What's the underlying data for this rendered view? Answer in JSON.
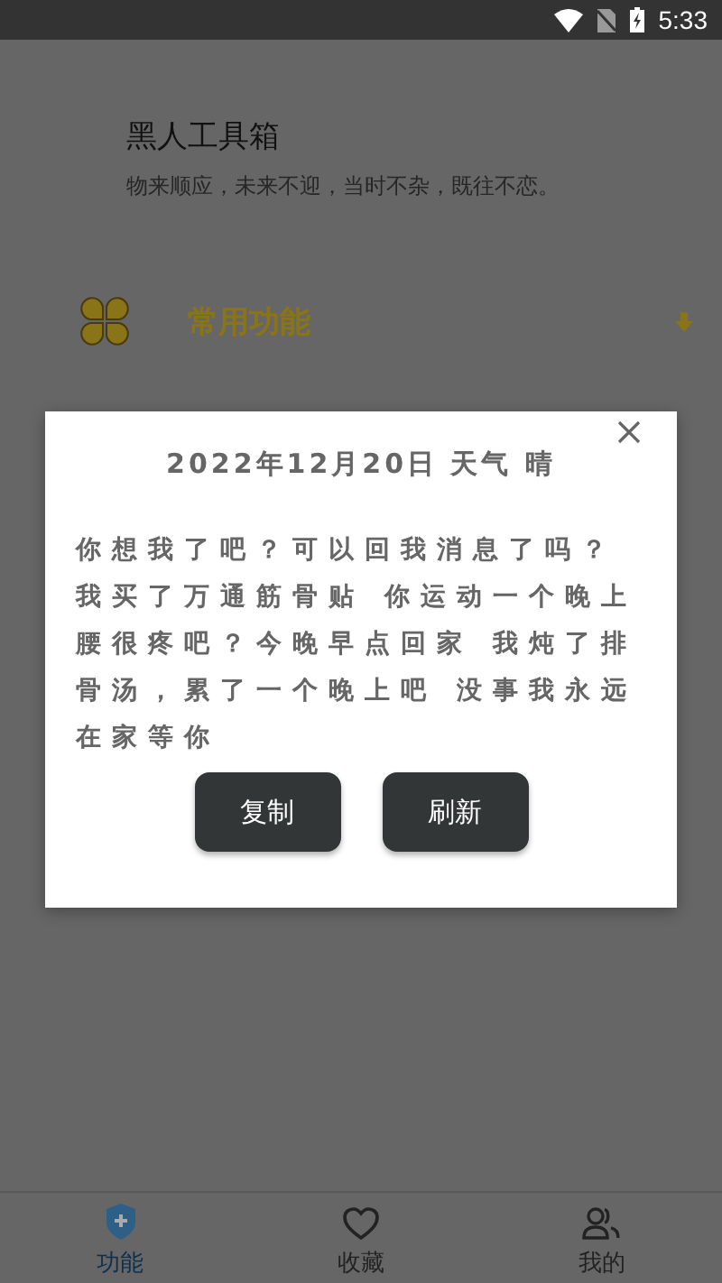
{
  "status_bar": {
    "time": "5:33"
  },
  "header": {
    "title": "黑人工具箱",
    "subtitle": "物来顺应，未来不迎，当时不杂，既往不恋。"
  },
  "section": {
    "title": "常用功能"
  },
  "dialog": {
    "title": "2022年12月20日 天气 晴",
    "message": "你想我了吧？可以回我消息了吗？我买了万通筋骨贴 你运动一个晚上腰很疼吧？今晚早点回家 我炖了排骨汤，累了一个晚上吧 没事我永远在家等你",
    "buttons": [
      "复制",
      "刷新"
    ]
  },
  "nav": [
    {
      "kind": "shield",
      "label": "功能",
      "selected": true
    },
    {
      "kind": "heart",
      "label": "收藏",
      "selected": false
    },
    {
      "kind": "people",
      "label": "我的",
      "selected": false
    }
  ]
}
